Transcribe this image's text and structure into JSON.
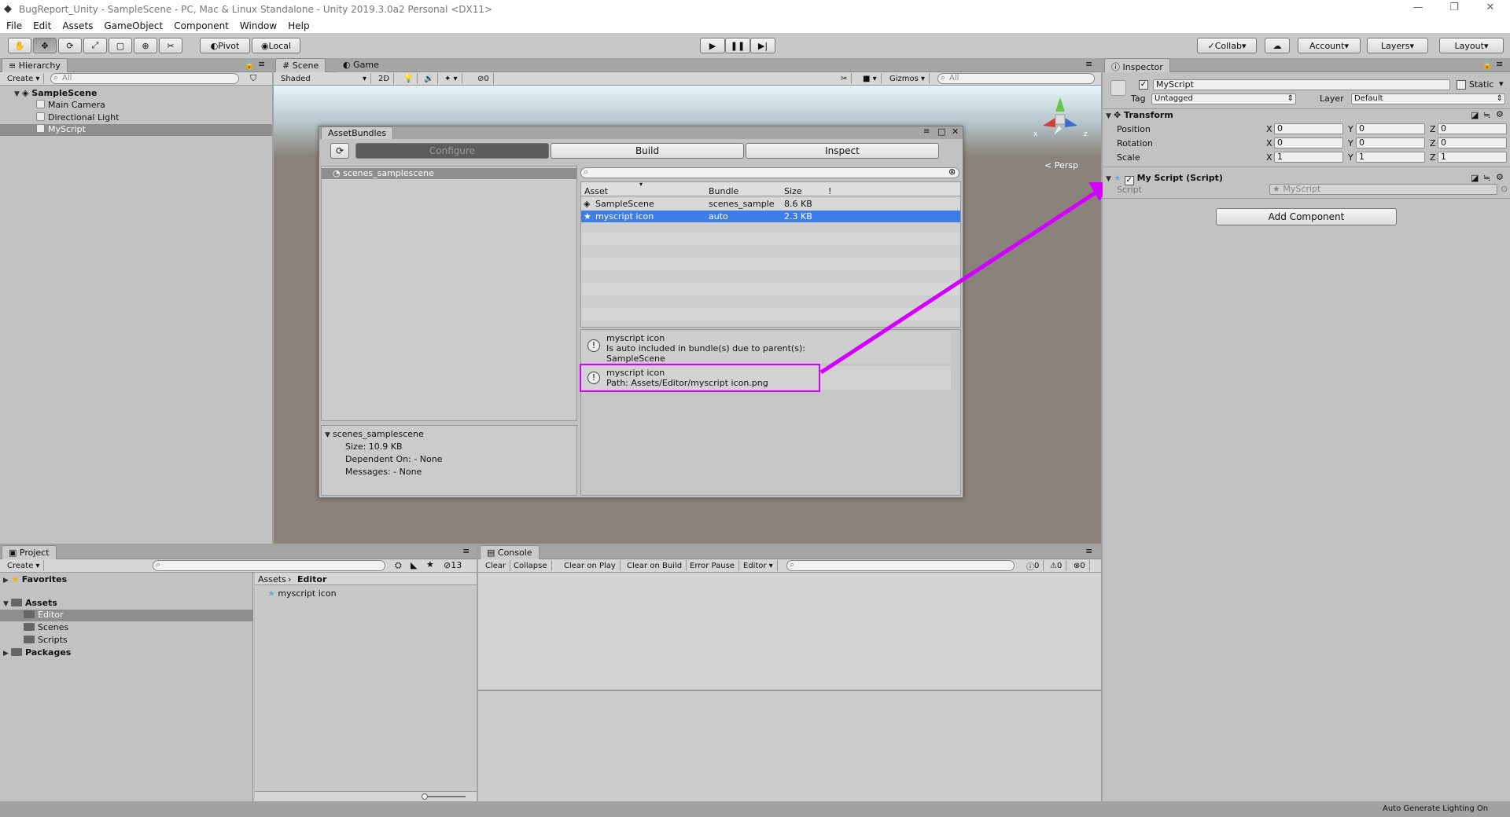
{
  "window": {
    "title": "BugReport_Unity - SampleScene - PC, Mac & Linux Standalone - Unity 2019.3.0a2 Personal <DX11>"
  },
  "menu": [
    "File",
    "Edit",
    "Assets",
    "GameObject",
    "Component",
    "Window",
    "Help"
  ],
  "toolbar": {
    "pivot": "Pivot",
    "local": "Local",
    "collab": "Collab",
    "account": "Account",
    "layers": "Layers",
    "layout": "Layout"
  },
  "hierarchy": {
    "tab": "Hierarchy",
    "create": "Create",
    "search": "All",
    "scene": "SampleScene",
    "items": [
      "Main Camera",
      "Directional Light",
      "MyScript"
    ]
  },
  "scene": {
    "tab_scene": "Scene",
    "tab_game": "Game",
    "shaded": "Shaded",
    "btn_2d": "2D",
    "fx_count": "0",
    "gizmos": "Gizmos",
    "search": "All",
    "persp": "Persp",
    "axis_x": "x",
    "axis_z": "z"
  },
  "assetbundles": {
    "title": "AssetBundles",
    "tabs": [
      "Configure",
      "Build",
      "Inspect"
    ],
    "bundle_list": [
      "scenes_samplescene"
    ],
    "columns": [
      "Asset",
      "Bundle",
      "Size",
      "!"
    ],
    "rows": [
      {
        "asset": "SampleScene",
        "bundle": "scenes_sample",
        "size": "8.6 KB"
      },
      {
        "asset": "myscript icon",
        "bundle": "auto",
        "size": "2.3 KB"
      }
    ],
    "messages": [
      {
        "lines": [
          "myscript icon",
          "Is auto included in bundle(s) due to parent(s):",
          "SampleScene"
        ]
      },
      {
        "lines": [
          "myscript icon",
          "Path: Assets/Editor/myscript icon.png"
        ]
      }
    ],
    "detail": {
      "name": "scenes_samplescene",
      "size": "Size: 10.9 KB",
      "dependent": "Dependent On: - None",
      "messages": "Messages: - None"
    }
  },
  "inspector": {
    "tab": "Inspector",
    "name": "MyScript",
    "static": "Static",
    "tag_label": "Tag",
    "tag": "Untagged",
    "layer_label": "Layer",
    "layer": "Default",
    "transform": "Transform",
    "props": [
      {
        "label": "Position",
        "x": "0",
        "y": "0",
        "z": "0"
      },
      {
        "label": "Rotation",
        "x": "0",
        "y": "0",
        "z": "0"
      },
      {
        "label": "Scale",
        "x": "1",
        "y": "1",
        "z": "1"
      }
    ],
    "script_comp": "My Script (Script)",
    "script_label": "Script",
    "script_value": "MyScript",
    "add_component": "Add Component"
  },
  "project": {
    "tab": "Project",
    "create": "Create",
    "favorites": "Favorites",
    "assets": "Assets",
    "folders": [
      "Editor",
      "Scenes",
      "Scripts"
    ],
    "packages": "Packages",
    "crumb1": "Assets",
    "crumb2": "Editor",
    "file": "myscript icon",
    "count": "13"
  },
  "console": {
    "tab": "Console",
    "buttons": [
      "Clear",
      "Collapse",
      "Clear on Play",
      "Clear on Build",
      "Error Pause",
      "Editor"
    ],
    "counts": [
      "0",
      "0",
      "0"
    ]
  },
  "status": {
    "text": "Auto Generate Lighting On"
  },
  "colors": {
    "accent": "#3e7de7",
    "annotation": "#d400ff"
  }
}
